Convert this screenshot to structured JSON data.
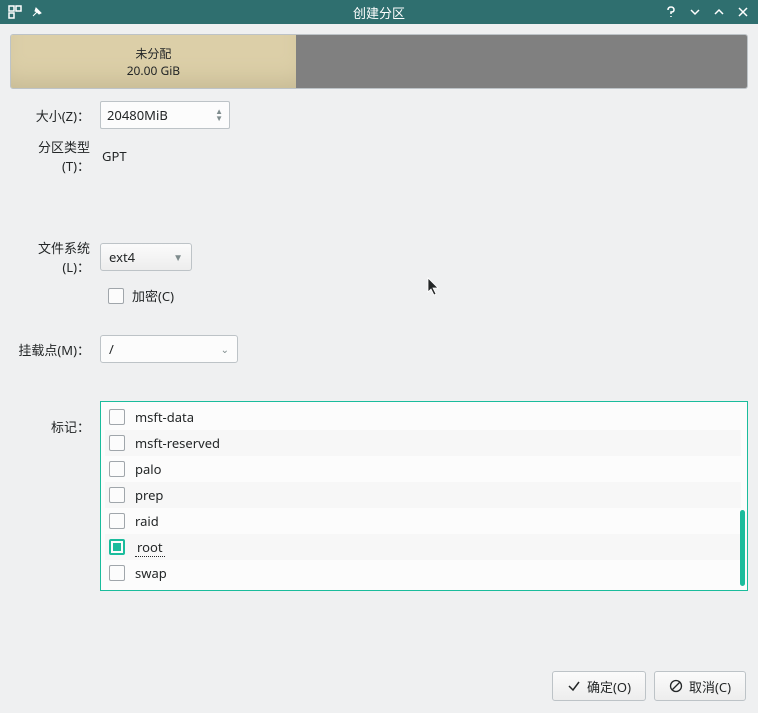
{
  "titlebar": {
    "title": "创建分区"
  },
  "partition": {
    "unallocated_label": "未分配",
    "unallocated_size": "20.00 GiB"
  },
  "form": {
    "size_label": "大小(Z)：",
    "size_value": "20480MiB",
    "type_label": "分区类型(T)：",
    "type_value": "GPT",
    "fs_label": "文件系统 (L)：",
    "fs_value": "ext4",
    "encrypt_label": "加密(C)",
    "mount_label": "挂载点(M)：",
    "mount_value": "/",
    "flags_label": "标记："
  },
  "flags": [
    {
      "label": "msft-data",
      "checked": false
    },
    {
      "label": "msft-reserved",
      "checked": false
    },
    {
      "label": "palo",
      "checked": false
    },
    {
      "label": "prep",
      "checked": false
    },
    {
      "label": "raid",
      "checked": false
    },
    {
      "label": "root",
      "checked": true
    },
    {
      "label": "swap",
      "checked": false
    }
  ],
  "buttons": {
    "ok": "确定(O)",
    "cancel": "取消(C)"
  }
}
